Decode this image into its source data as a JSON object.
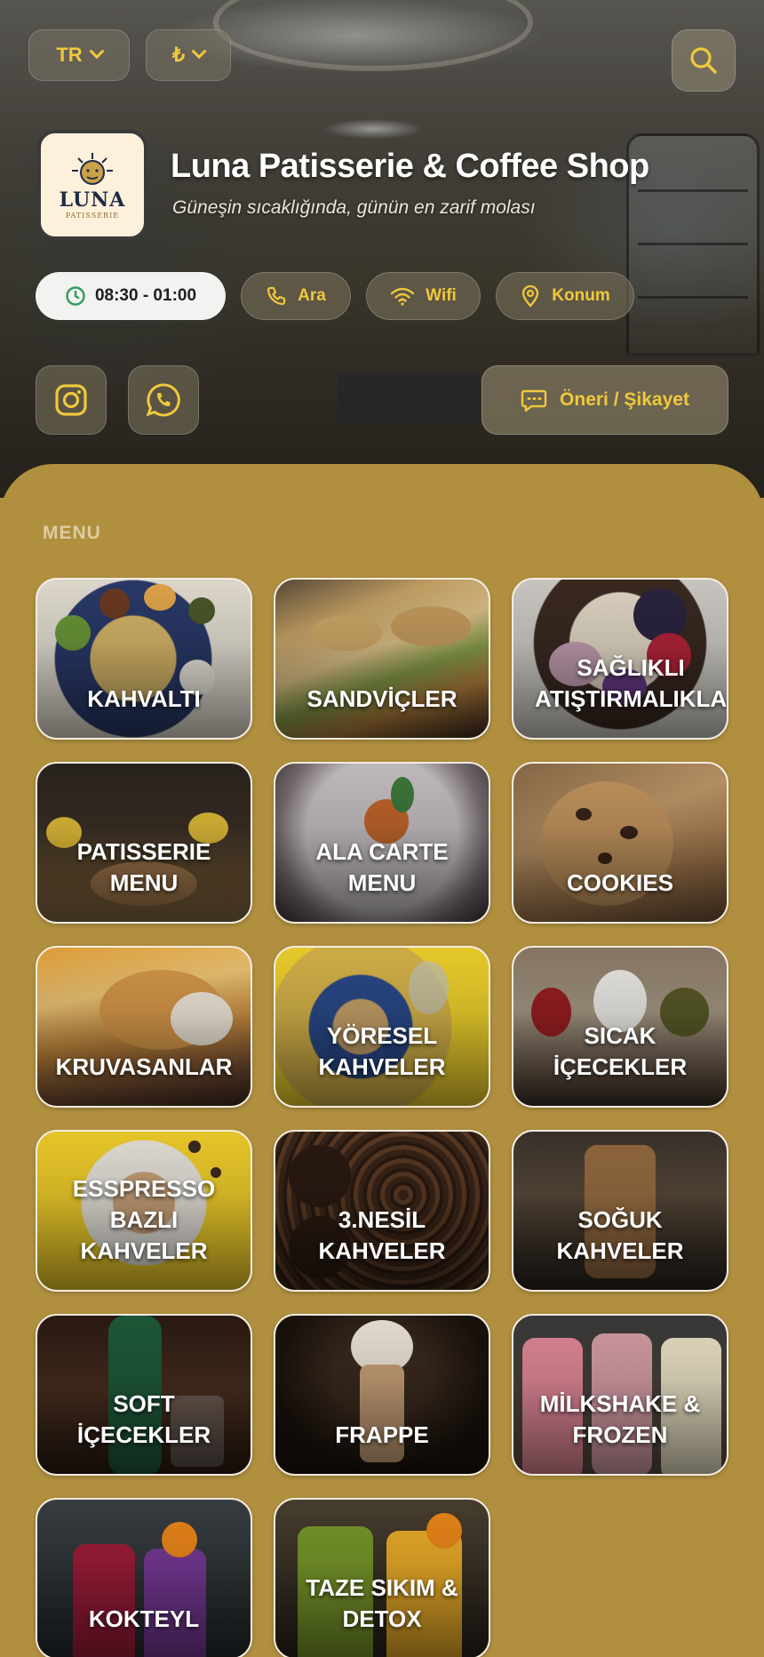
{
  "header": {
    "language": "TR",
    "currency": "₺",
    "search_icon": "search-icon",
    "logo_text": "LUNA",
    "logo_subtext": "PATISSERIE",
    "title": "Luna Patisserie & Coffee Shop",
    "subtitle": "Güneşin sıcaklığında, günün en zarif molası",
    "hours": "08:30 - 01:00",
    "actions": {
      "call": "Ara",
      "wifi": "Wifi",
      "location": "Konum"
    },
    "feedback": "Öneri / Şikayet"
  },
  "colors": {
    "accent": "#f0c83c",
    "panel": "#b08f3f",
    "hours_icon": "#2e9e5b"
  },
  "menu": {
    "heading": "MENU",
    "categories": [
      "KAHVALTI",
      "SANDVİÇLER",
      "SAĞLIKLI\nATIŞTIRMALIKLA",
      "PATISSERIE\nMENU",
      "ALA CARTE\nMENU",
      "COOKIES",
      "KRUVASANLAR",
      "YÖRESEL\nKAHVELER",
      "SICAK\nİÇECEKLER",
      "ESSPRESSO\nBAZLI\nKAHVELER",
      "3.NESİL\nKAHVELER",
      "SOĞUK\nKAHVELER",
      "SOFT\nİÇECEKLER",
      "FRAPPE",
      "MİLKSHAKE &\nFROZEN",
      "KOKTEYL",
      "TAZE SIKIM &\nDETOX"
    ]
  }
}
